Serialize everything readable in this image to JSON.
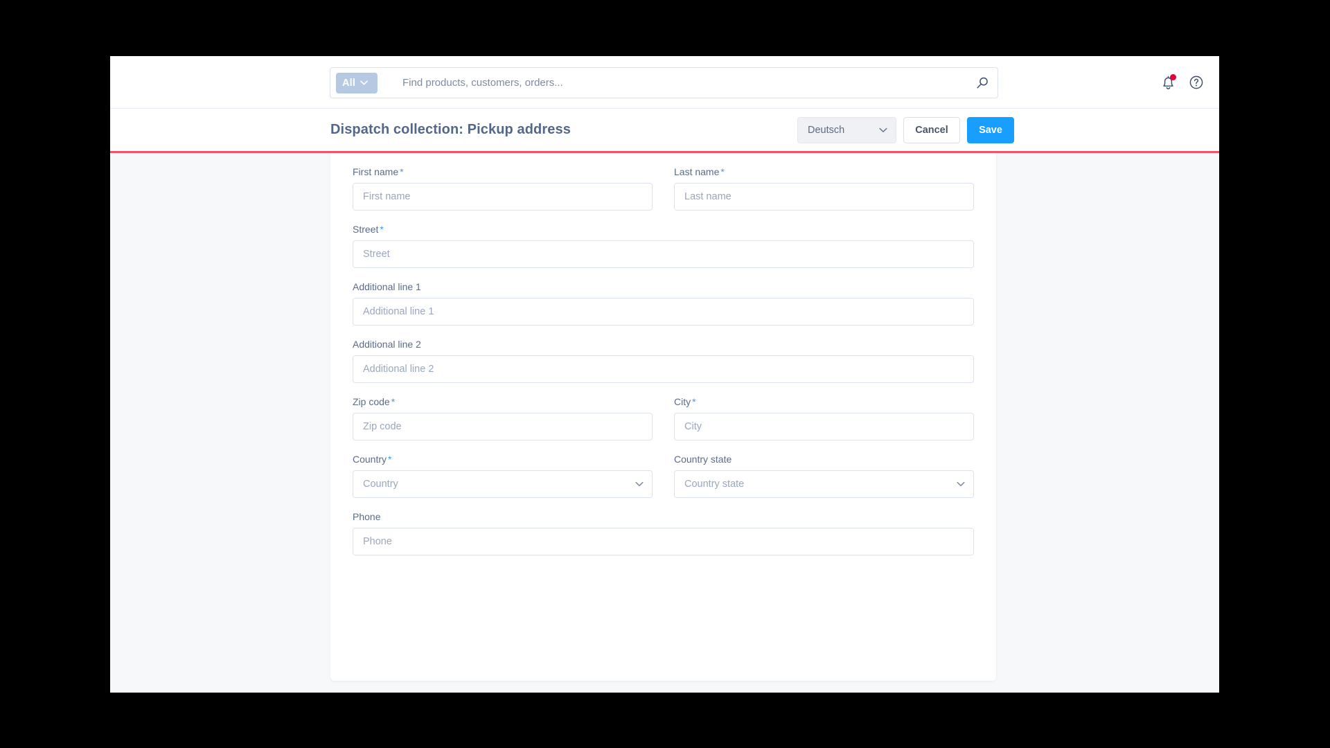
{
  "topbar": {
    "scope_label": "All",
    "scope_icon": "chevron-down-icon",
    "search_placeholder": "Find products, customers, orders...",
    "search_value": "",
    "search_icon": "search-icon",
    "notifications_icon": "bell-icon",
    "help_icon": "help-circle-icon"
  },
  "header": {
    "title": "Dispatch collection: Pickup address",
    "language": "Deutsch",
    "language_icon": "chevron-down-icon",
    "cancel_label": "Cancel",
    "save_label": "Save"
  },
  "form": {
    "rows": [
      {
        "fields": [
          {
            "label": "First name",
            "required": true,
            "placeholder": "First name",
            "type": "text"
          },
          {
            "label": "Last name",
            "required": true,
            "placeholder": "Last name",
            "type": "text"
          }
        ]
      },
      {
        "fields": [
          {
            "label": "Street",
            "required": true,
            "placeholder": "Street",
            "type": "text"
          }
        ]
      },
      {
        "fields": [
          {
            "label": "Additional line 1",
            "required": false,
            "placeholder": "Additional line 1",
            "type": "text"
          }
        ]
      },
      {
        "fields": [
          {
            "label": "Additional line 2",
            "required": false,
            "placeholder": "Additional line 2",
            "type": "text"
          }
        ]
      },
      {
        "fields": [
          {
            "label": "Zip code",
            "required": true,
            "placeholder": "Zip code",
            "type": "text"
          },
          {
            "label": "City",
            "required": true,
            "placeholder": "City",
            "type": "text"
          }
        ]
      },
      {
        "fields": [
          {
            "label": "Country",
            "required": true,
            "placeholder": "Country",
            "type": "select"
          },
          {
            "label": "Country state",
            "required": false,
            "placeholder": "Country state",
            "type": "select"
          }
        ]
      },
      {
        "fields": [
          {
            "label": "Phone",
            "required": false,
            "placeholder": "Phone",
            "type": "text"
          }
        ]
      }
    ]
  },
  "colors": {
    "accent_blue": "#189eff",
    "accent_rule": "#f5516a",
    "notification_dot": "#e4003a",
    "title": "#52678a",
    "scope_pill": "#b5c9e3"
  }
}
